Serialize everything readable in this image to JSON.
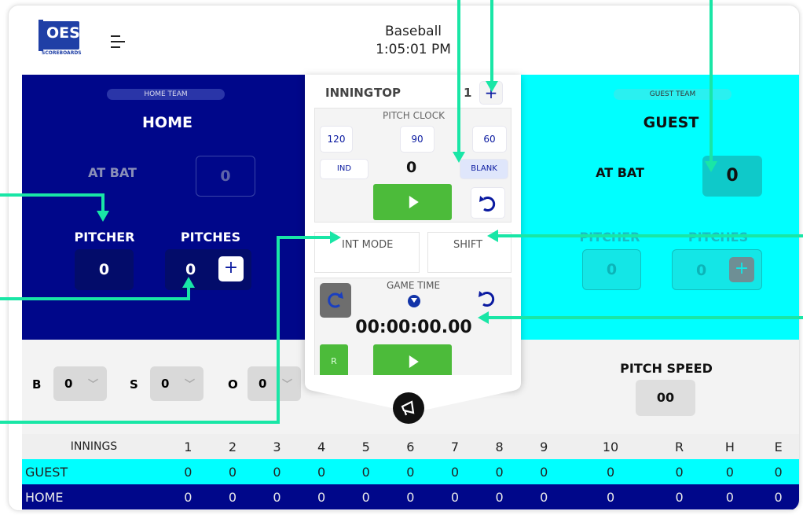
{
  "header": {
    "sport": "Baseball",
    "time": "1:05:01 PM",
    "logo_text": "OES",
    "logo_sub": "SCOREBOARDS"
  },
  "home": {
    "badge": "HOME TEAM",
    "name": "HOME",
    "at_bat_label": "AT BAT",
    "at_bat": "0",
    "pitcher_label": "PITCHER",
    "pitches_label": "PITCHES",
    "pitcher": "0",
    "pitches": "0",
    "plus": "+"
  },
  "guest": {
    "badge": "GUEST TEAM",
    "name": "GUEST",
    "at_bat_label": "AT BAT",
    "at_bat": "0",
    "pitcher_label": "PITCHER",
    "pitches_label": "PITCHES",
    "pitcher": "0",
    "pitches": "0",
    "plus": "+"
  },
  "inning": {
    "label": "INNING",
    "half": "TOP",
    "number": "1",
    "plus": "+"
  },
  "pitch_clock": {
    "title": "PITCH CLOCK",
    "presets": [
      "120",
      "90",
      "60"
    ],
    "ind": "IND",
    "value": "0",
    "blank": "BLANK"
  },
  "modes": {
    "int_mode": "INT MODE",
    "shift": "SHIFT"
  },
  "game_time": {
    "title": "GAME TIME",
    "value": "00:00:00.00",
    "r": "R"
  },
  "count": {
    "b_label": "B",
    "b": "0",
    "s_label": "S",
    "s": "0",
    "o_label": "O",
    "o": "0"
  },
  "pitch_speed": {
    "label": "PITCH SPEED",
    "value": "00"
  },
  "innings_table": {
    "headers": [
      "INNINGS",
      "1",
      "2",
      "3",
      "4",
      "5",
      "6",
      "7",
      "8",
      "9",
      "10",
      "R",
      "H",
      "E"
    ],
    "rows": [
      {
        "team": "GUEST",
        "values": [
          "0",
          "0",
          "0",
          "0",
          "0",
          "0",
          "0",
          "0",
          "0",
          "0",
          "0",
          "0",
          "0"
        ]
      },
      {
        "team": "HOME",
        "values": [
          "0",
          "0",
          "0",
          "0",
          "0",
          "0",
          "0",
          "0",
          "0",
          "0",
          "0",
          "0",
          "0"
        ]
      }
    ]
  },
  "colors": {
    "home": "#00078a",
    "guest": "#00ffff",
    "green": "#4cbb3a",
    "annotation": "#19e6a6"
  }
}
